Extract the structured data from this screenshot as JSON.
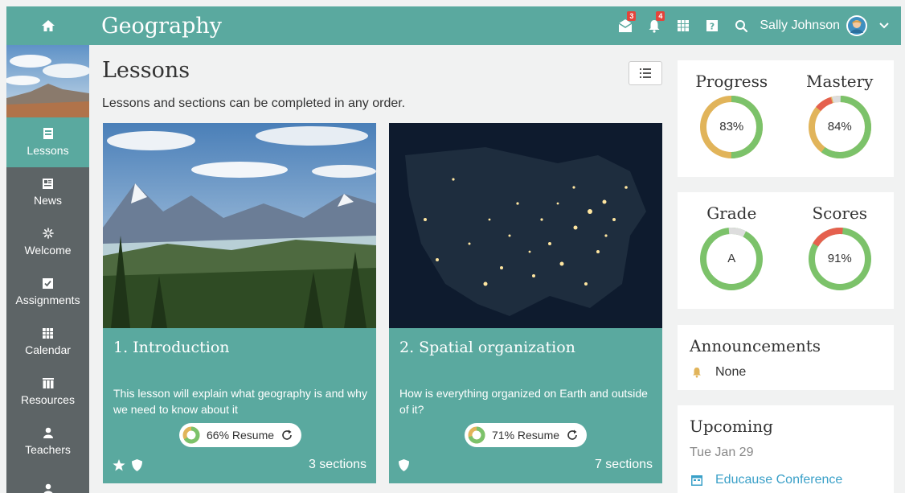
{
  "app": {
    "title": "Geography",
    "user_name": "Sally Johnson"
  },
  "header": {
    "mail_badge": "3",
    "bell_badge": "4"
  },
  "sidebar": {
    "items": [
      {
        "label": "Lessons",
        "icon": "lessons-icon",
        "active": true
      },
      {
        "label": "News",
        "icon": "news-icon"
      },
      {
        "label": "Welcome",
        "icon": "welcome-icon"
      },
      {
        "label": "Assignments",
        "icon": "assignments-icon"
      },
      {
        "label": "Calendar",
        "icon": "calendar-icon"
      },
      {
        "label": "Resources",
        "icon": "resources-icon"
      },
      {
        "label": "Teachers",
        "icon": "teachers-icon"
      },
      {
        "label": "",
        "icon": "user-icon"
      }
    ]
  },
  "page": {
    "title": "Lessons",
    "subtitle": "Lessons and sections can be completed in any order."
  },
  "lessons": [
    {
      "title": "1. Introduction",
      "description": "This lesson will explain what geography is and why we need to know about it",
      "resume_label": "66% Resume",
      "progress": 0.66,
      "sections": "3 sections"
    },
    {
      "title": "2. Spatial organization",
      "description": "How is everything organized on Earth and outside of it?",
      "resume_label": "71% Resume",
      "progress": 0.71,
      "sections": "7 sections"
    }
  ],
  "stats": {
    "progress": {
      "label": "Progress",
      "value": "83%"
    },
    "mastery": {
      "label": "Mastery",
      "value": "84%"
    },
    "grade": {
      "label": "Grade",
      "value": "A"
    },
    "scores": {
      "label": "Scores",
      "value": "91%"
    }
  },
  "announcements": {
    "title": "Announcements",
    "value": "None"
  },
  "upcoming": {
    "title": "Upcoming",
    "date": "Tue Jan 29",
    "event": "Educause Conference"
  },
  "colors": {
    "teal": "#5aa99f",
    "sidebar": "#5d6466",
    "green": "#7cc26a",
    "orange": "#e1b45a",
    "red": "#e5604e",
    "link": "#3aa0c8"
  }
}
